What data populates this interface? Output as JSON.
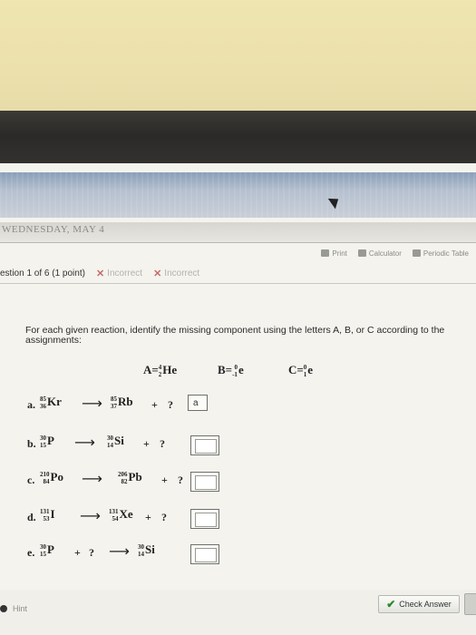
{
  "header": {
    "banner_text": "WEDNESDAY, MAY 4"
  },
  "toolbar": {
    "print": "Print",
    "calculator": "Calculator",
    "periodic_table": "Periodic Table"
  },
  "question": {
    "title": "estion 1 of 6 (1 point)",
    "attempts": [
      "Incorrect",
      "Incorrect"
    ]
  },
  "prompt": "For each given reaction, identify the missing component using the letters A, B, or C according to the assignments:",
  "definitions": [
    {
      "label": "A",
      "eq": "=",
      "mass": "4",
      "atomic": "2",
      "symbol": "He"
    },
    {
      "label": "B",
      "eq": "=",
      "mass": "0",
      "atomic": "-1",
      "symbol": "e"
    },
    {
      "label": "C",
      "eq": "=",
      "mass": "0",
      "atomic": "1",
      "symbol": "e"
    }
  ],
  "reactions": [
    {
      "letter": "a.",
      "lhs": [
        {
          "mass": "85",
          "atomic": "36",
          "sym": "Kr"
        }
      ],
      "rhs": [
        {
          "mass": "85",
          "atomic": "37",
          "sym": "Rb"
        }
      ],
      "plus": "+",
      "q": "?",
      "answer": "a"
    },
    {
      "letter": "b.",
      "lhs": [
        {
          "mass": "30",
          "atomic": "15",
          "sym": "P"
        }
      ],
      "rhs": [
        {
          "mass": "30",
          "atomic": "14",
          "sym": "Si"
        }
      ],
      "plus": "+",
      "q": "?",
      "answer": ""
    },
    {
      "letter": "c.",
      "lhs": [
        {
          "mass": "210",
          "atomic": "84",
          "sym": "Po"
        }
      ],
      "rhs": [
        {
          "mass": "206",
          "atomic": "82",
          "sym": "Pb"
        }
      ],
      "plus": "+",
      "q": "?",
      "answer": ""
    },
    {
      "letter": "d.",
      "lhs": [
        {
          "mass": "131",
          "atomic": "53",
          "sym": "I"
        }
      ],
      "rhs": [
        {
          "mass": "131",
          "atomic": "54",
          "sym": "Xe"
        }
      ],
      "plus": "+",
      "q": "?",
      "answer": ""
    },
    {
      "letter": "e.",
      "lhs": [
        {
          "mass": "30",
          "atomic": "15",
          "sym": "P"
        }
      ],
      "rhs": [
        {
          "mass": "30",
          "atomic": "14",
          "sym": "Si"
        }
      ],
      "plus": "+",
      "q": "?",
      "answer": ""
    }
  ],
  "footer": {
    "hint": "Hint",
    "check": "Check Answer"
  },
  "colors": {
    "incorrect": "#c86a6a",
    "check_tick": "#2a8a2a"
  }
}
